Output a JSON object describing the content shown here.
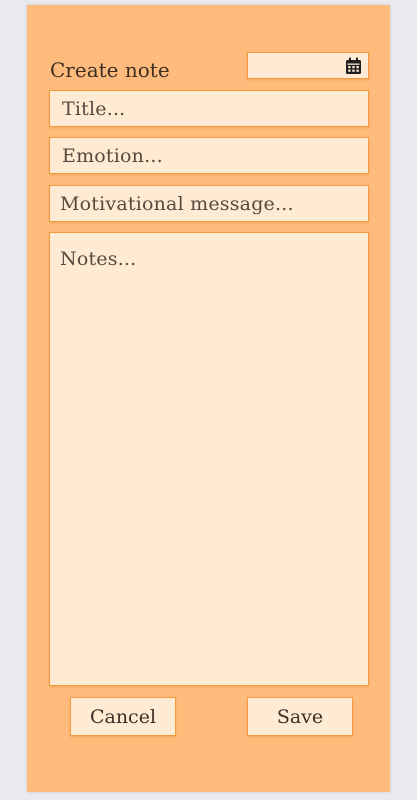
{
  "header": {
    "title": "Create note",
    "date_value": "",
    "calendar_icon": "calendar-icon"
  },
  "form": {
    "title_placeholder": "Title...",
    "emotion_placeholder": "Emotion...",
    "motivational_placeholder": "Motivational message...",
    "notes_placeholder": "Notes..."
  },
  "actions": {
    "cancel_label": "Cancel",
    "save_label": "Save"
  },
  "colors": {
    "card_background": "#ffbb7b",
    "field_background": "#ffebd4",
    "field_border": "#f39a3a",
    "page_background": "#e9e9ee"
  }
}
